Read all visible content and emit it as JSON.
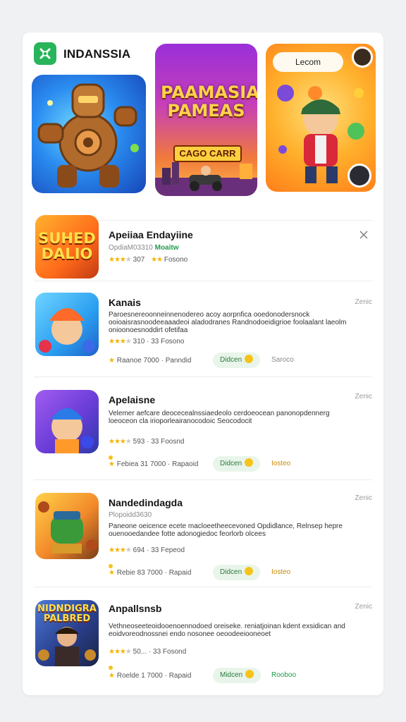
{
  "header": {
    "brand": "INDANSSIA"
  },
  "banners": {
    "center": {
      "title": "PAAMASIA PAMEAS",
      "subtitle": "CAGO CARR"
    },
    "right": {
      "pill": "Lecom"
    }
  },
  "colors": {
    "accent_green": "#28b45a",
    "star": "#f5b400",
    "coin": "#f6c31b"
  },
  "games": [
    {
      "title": "Apeiiaa Endayiine",
      "sub": "OpdiaM03310",
      "sub_badge": "Moaitw",
      "rating_text": "307",
      "rating_extra": "Fosono",
      "icon": "bookmark-icon"
    },
    {
      "title": "Kanais",
      "right_meta": "Zenic",
      "desc": "Paroesnereoonneinnenodereo acoy aorpnfica ooedonodersnock ooioaisrasnoodeeaaadeoi aladodranes Randnodoeidigrioe foolaalant laeolm onioonoesnoddirt ofetifaa",
      "rating_text": "310 · 33 Fosono",
      "meta": "Raanoe 7000 · Panndid",
      "button": "Didcen",
      "extra": "Saroco"
    },
    {
      "title": "Apelaisne",
      "right_meta": "Zenic",
      "desc": "Velemer aefcare deocecealnssiaedeolo cerdoeocean panonopdennerg loeoceon cla irioporleairanocodoic Seocodocit",
      "rating_text": "593 · 33 Foosnd",
      "meta": "Febiea 31 7000 · Rapaoid",
      "button": "Didcen",
      "extra": "Iosteo"
    },
    {
      "title": "Nandedindagda",
      "right_meta": "Zenic",
      "sub": "Plopoidd3630",
      "desc": "Paneone oeicence ecete macloeetheecevoned Opdidlance, Relnsep hepre ouenooedandee fotte adonogiedoc feorlorb olcees",
      "rating_text": "694 · 33 Fepeod",
      "meta": "Rebie 83 7000 · Rapaid",
      "button": "Didcen",
      "extra": "Iosteo"
    },
    {
      "title": "Anpallsnsb",
      "right_meta": "Zenic",
      "desc": "Vethneoseeteoidooenoennodoed oreiseke. reniatjoinan kdent exsidican and eoidvoreodnossnei endo nosonee oeoodeeiooneoet",
      "rating_text": "50... · 33 Fosond",
      "meta": "Roelde 1 7000 · Rapaid",
      "button": "Midcen",
      "extra": "Rooboo"
    }
  ]
}
